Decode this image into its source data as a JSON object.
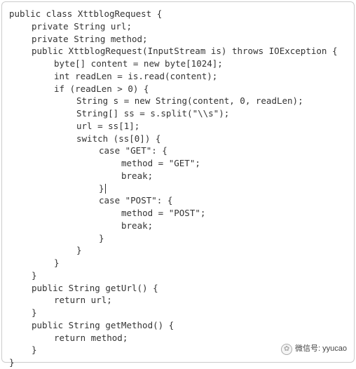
{
  "code": {
    "lines": [
      {
        "indent": 0,
        "text": "public class XttblogRequest {"
      },
      {
        "indent": 1,
        "text": "private String url;"
      },
      {
        "indent": 1,
        "text": "private String method;"
      },
      {
        "indent": 1,
        "text": "public XttblogRequest(InputStream is) throws IOException {"
      },
      {
        "indent": 2,
        "text": "byte[] content = new byte[1024];"
      },
      {
        "indent": 2,
        "text": "int readLen = is.read(content);"
      },
      {
        "indent": 2,
        "text": "if (readLen > 0) {"
      },
      {
        "indent": 3,
        "text": "String s = new String(content, 0, readLen);"
      },
      {
        "indent": 3,
        "text": "String[] ss = s.split(\"\\\\s\");"
      },
      {
        "indent": 3,
        "text": "url = ss[1];"
      },
      {
        "indent": 3,
        "text": "switch (ss[0]) {"
      },
      {
        "indent": 4,
        "text": "case \"GET\": {"
      },
      {
        "indent": 5,
        "text": "method = \"GET\";"
      },
      {
        "indent": 5,
        "text": "break;"
      },
      {
        "indent": 4,
        "text": "}",
        "caret": true
      },
      {
        "indent": 4,
        "text": "case \"POST\": {"
      },
      {
        "indent": 5,
        "text": "method = \"POST\";"
      },
      {
        "indent": 5,
        "text": "break;"
      },
      {
        "indent": 4,
        "text": "}"
      },
      {
        "indent": 3,
        "text": "}"
      },
      {
        "indent": 2,
        "text": "}"
      },
      {
        "indent": 1,
        "text": "}"
      },
      {
        "indent": 1,
        "text": "public String getUrl() {"
      },
      {
        "indent": 2,
        "text": "return url;"
      },
      {
        "indent": 1,
        "text": "}"
      },
      {
        "indent": 1,
        "text": "public String getMethod() {"
      },
      {
        "indent": 2,
        "text": "return method;"
      },
      {
        "indent": 1,
        "text": "}"
      },
      {
        "indent": 0,
        "text": "}"
      }
    ]
  },
  "watermark": {
    "label": "微信号: yyucao"
  }
}
